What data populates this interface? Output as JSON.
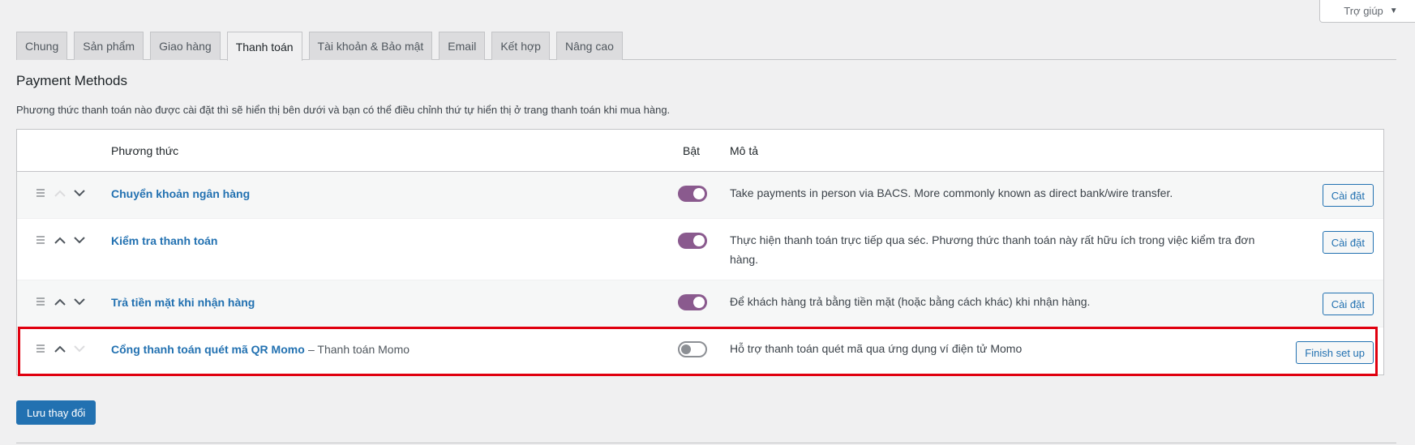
{
  "help": {
    "label": "Trợ giúp",
    "caret": "▼"
  },
  "tabs": [
    {
      "label": "Chung"
    },
    {
      "label": "Sản phẩm"
    },
    {
      "label": "Giao hàng"
    },
    {
      "label": "Thanh toán"
    },
    {
      "label": "Tài khoản & Bảo mật"
    },
    {
      "label": "Email"
    },
    {
      "label": "Kết hợp"
    },
    {
      "label": "Nâng cao"
    }
  ],
  "section": {
    "title": "Payment Methods",
    "description": "Phương thức thanh toán nào được cài đặt thì sẽ hiển thị bên dưới và bạn có thể điều chỉnh thứ tự hiển thị ở trang thanh toán khi mua hàng."
  },
  "table": {
    "headers": {
      "method": "Phương thức",
      "enabled": "Bật",
      "description": "Mô tả"
    },
    "rows": [
      {
        "name": "Chuyển khoản ngân hàng",
        "extra": "",
        "enabled": true,
        "description": "Take payments in person via BACS. More commonly known as direct bank/wire transfer.",
        "action": "Cài đặt"
      },
      {
        "name": "Kiểm tra thanh toán",
        "extra": "",
        "enabled": true,
        "description": "Thực hiện thanh toán trực tiếp qua séc. Phương thức thanh toán này rất hữu ích trong việc kiểm tra đơn hàng.",
        "action": "Cài đặt"
      },
      {
        "name": "Trả tiền mặt khi nhận hàng",
        "extra": "",
        "enabled": true,
        "description": "Để khách hàng trả bằng tiền mặt (hoặc bằng cách khác) khi nhận hàng.",
        "action": "Cài đặt"
      },
      {
        "name": "Cổng thanh toán quét mã QR Momo",
        "extra": "– Thanh toán Momo",
        "enabled": false,
        "description": "Hỗ trợ thanh toán quét mã qua ứng dụng ví điện tử Momo",
        "action": "Finish set up"
      }
    ]
  },
  "save_button": "Lưu thay đổi",
  "colors": {
    "accent": "#2271b1",
    "toggle_on": "#8a5a8e",
    "highlight": "#e0000f"
  }
}
